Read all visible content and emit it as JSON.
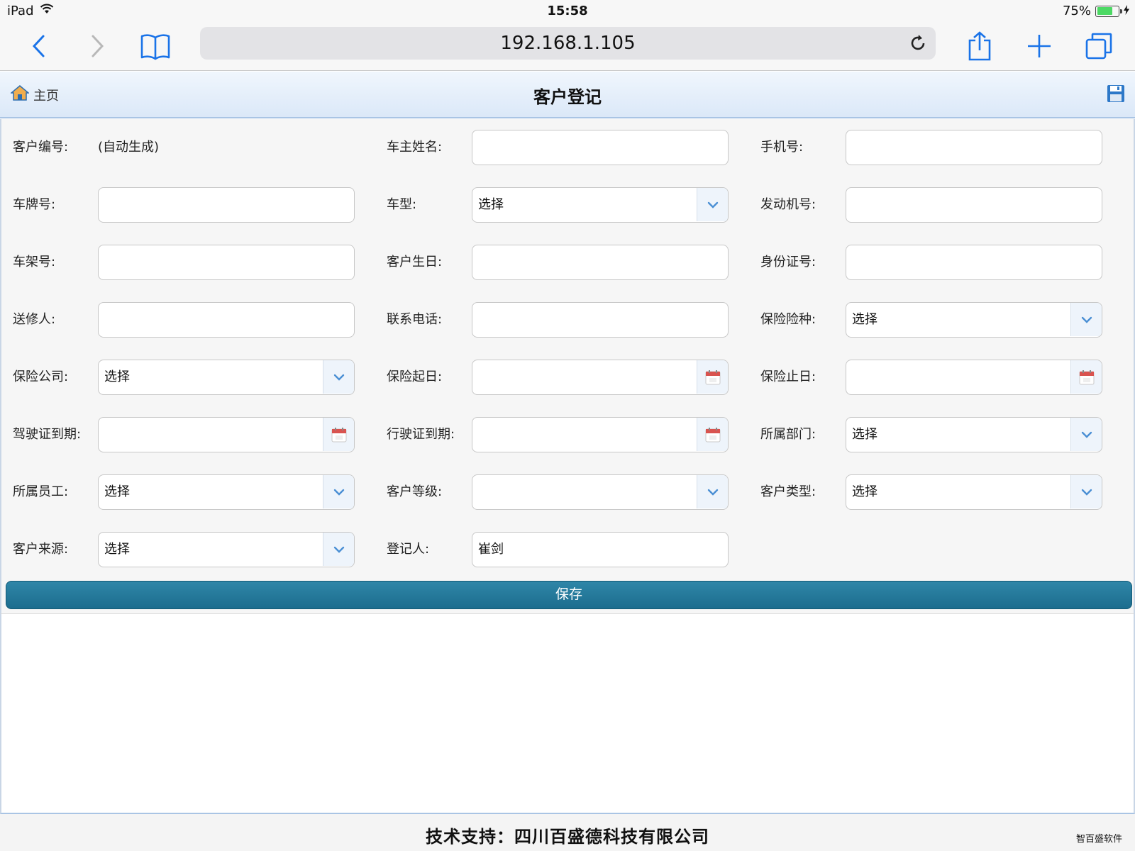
{
  "status_bar": {
    "device": "iPad",
    "time": "15:58",
    "battery_percent": "75%",
    "battery_level": 0.75
  },
  "browser": {
    "url": "192.168.1.105"
  },
  "header": {
    "home_label": "主页",
    "title": "客户登记"
  },
  "form": {
    "rows": [
      [
        {
          "label": "客户编号:",
          "type": "static",
          "value": "(自动生成)"
        },
        {
          "label": "车主姓名:",
          "type": "text",
          "value": ""
        },
        {
          "label": "手机号:",
          "type": "text",
          "value": ""
        }
      ],
      [
        {
          "label": "车牌号:",
          "type": "text",
          "value": ""
        },
        {
          "label": "车型:",
          "type": "select",
          "value": "选择"
        },
        {
          "label": "发动机号:",
          "type": "text",
          "value": ""
        }
      ],
      [
        {
          "label": "车架号:",
          "type": "text",
          "value": ""
        },
        {
          "label": "客户生日:",
          "type": "text",
          "value": ""
        },
        {
          "label": "身份证号:",
          "type": "text",
          "value": ""
        }
      ],
      [
        {
          "label": "送修人:",
          "type": "text",
          "value": ""
        },
        {
          "label": "联系电话:",
          "type": "text",
          "value": ""
        },
        {
          "label": "保险险种:",
          "type": "select",
          "value": "选择"
        }
      ],
      [
        {
          "label": "保险公司:",
          "type": "select",
          "value": "选择"
        },
        {
          "label": "保险起日:",
          "type": "date",
          "value": ""
        },
        {
          "label": "保险止日:",
          "type": "date",
          "value": ""
        }
      ],
      [
        {
          "label": "驾驶证到期:",
          "type": "date",
          "value": ""
        },
        {
          "label": "行驶证到期:",
          "type": "date",
          "value": ""
        },
        {
          "label": "所属部门:",
          "type": "select",
          "value": "选择"
        }
      ],
      [
        {
          "label": "所属员工:",
          "type": "select",
          "value": "选择"
        },
        {
          "label": "客户等级:",
          "type": "select",
          "value": ""
        },
        {
          "label": "客户类型:",
          "type": "select",
          "value": "选择"
        }
      ],
      [
        {
          "label": "客户来源:",
          "type": "select",
          "value": "选择"
        },
        {
          "label": "登记人:",
          "type": "text",
          "value": "崔剑"
        }
      ]
    ],
    "save_label": "保存"
  },
  "footer": {
    "text": "技术支持：四川百盛德科技有限公司",
    "brand": "智百盛软件"
  },
  "colors": {
    "accent": "#237898",
    "header_bg": "#e3eefa",
    "chevron": "#4a8fd4",
    "calendar": "#d9534f"
  }
}
